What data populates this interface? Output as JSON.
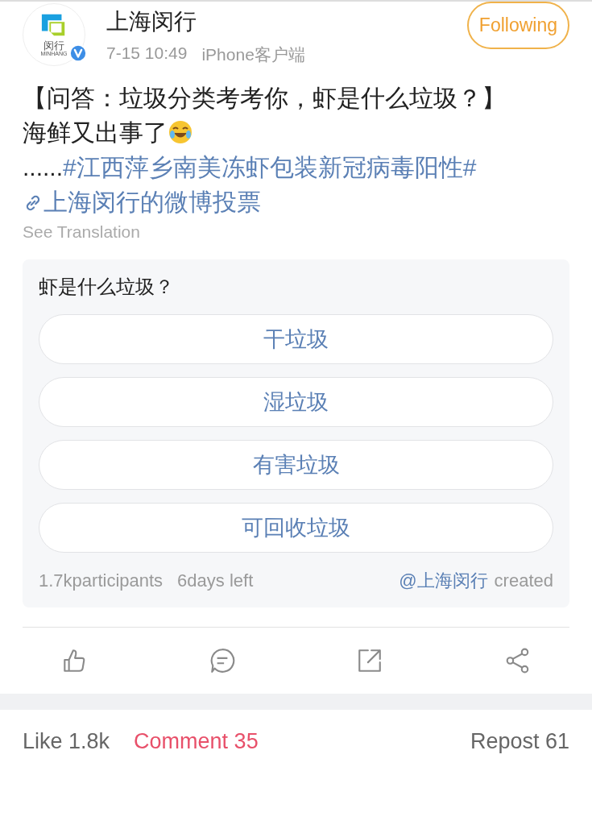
{
  "header": {
    "avatar": {
      "text": "闵行",
      "subtext": "MINHANG",
      "verified": true
    },
    "name": "上海闵行",
    "time": "7-15 10:49",
    "source": "iPhone客户端",
    "follow_button": {
      "label": "Following"
    }
  },
  "post": {
    "segments": [
      {
        "kind": "text",
        "text": "【问答：垃圾分类考考你，虾是什么垃圾？】海鲜又出事了"
      },
      {
        "kind": "emoji"
      },
      {
        "kind": "text",
        "text": "......"
      },
      {
        "kind": "hashtag",
        "text": "#江西萍乡南美冻虾包装新冠病毒阳性#"
      },
      {
        "kind": "link",
        "text": "上海闵行的微博投票"
      }
    ],
    "translate": "See Translation"
  },
  "poll": {
    "question": "虾是什么垃圾？",
    "options": [
      "干垃圾",
      "湿垃圾",
      "有害垃圾",
      "可回收垃圾"
    ],
    "participants": "1.7kparticipants",
    "time_left": "6days left",
    "creator": "@上海闵行",
    "creator_suffix": "created"
  },
  "tabs": [
    {
      "label": "Like 1.8k",
      "selected": false
    },
    {
      "label": "Comment 35",
      "selected": true
    },
    {
      "label": "Repost 61",
      "selected": false
    }
  ]
}
